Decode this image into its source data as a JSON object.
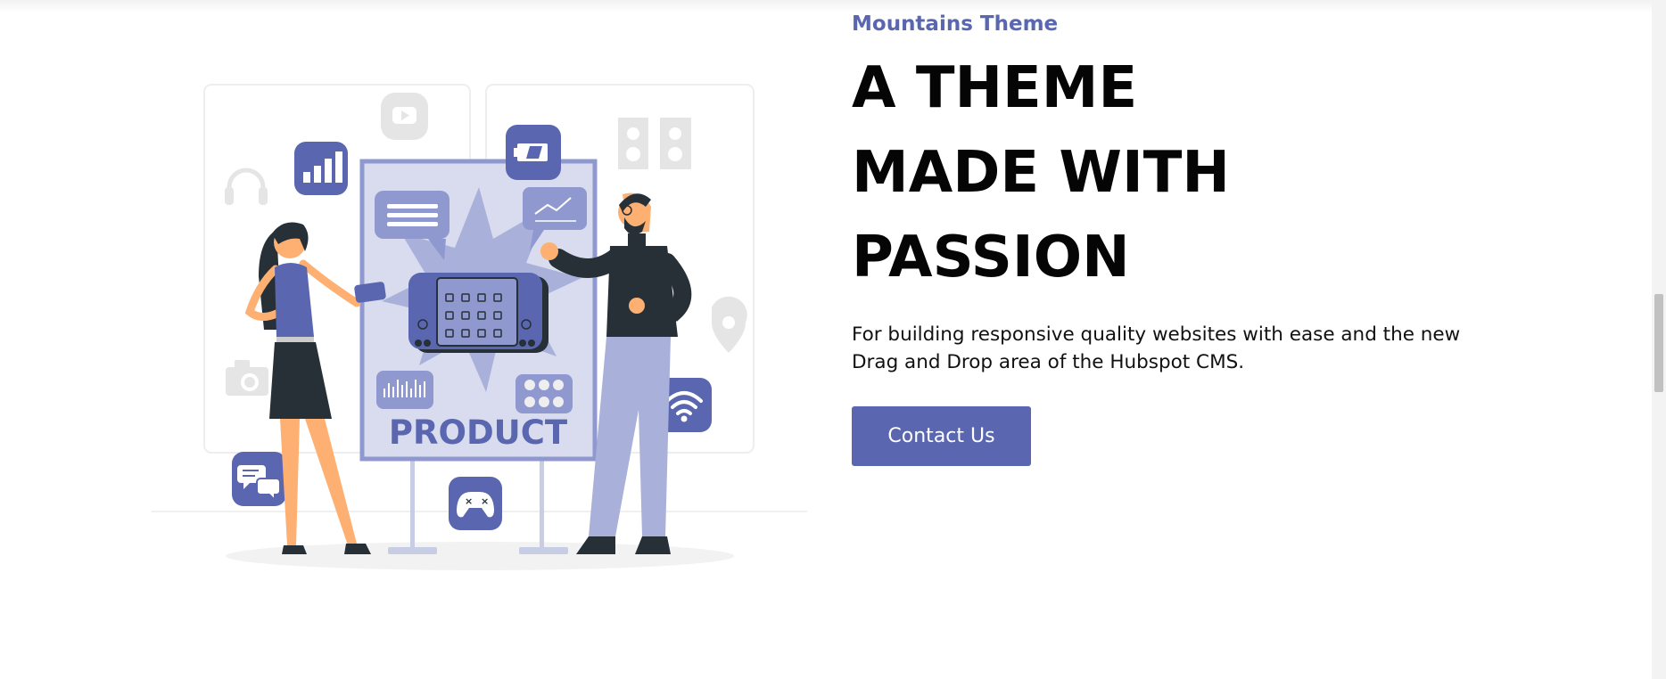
{
  "hero": {
    "eyebrow": "Mountains Theme",
    "headline": [
      "A THEME",
      "MADE WITH",
      "PASSION"
    ],
    "description": "For building responsive quality websites with ease and the new Drag and Drop area of the Hubspot CMS.",
    "cta_label": "Contact Us"
  },
  "illustration": {
    "board_text": "PRODUCT",
    "icons": [
      "youtube-icon",
      "bar-chart-icon",
      "battery-icon",
      "speakers-icon",
      "headphones-icon",
      "message-icon",
      "line-chart-icon",
      "map-pin-icon",
      "camera-icon",
      "chat-icon",
      "gamepad-icon",
      "wifi-icon",
      "audio-bars-icon",
      "buttons-grid-icon"
    ]
  },
  "colors": {
    "accent": "#5a67b0",
    "accent_light": "#8f99cf",
    "accent_pale": "#d8dcee",
    "heading": "#050505",
    "text": "#111111",
    "skin": "#fdb072",
    "dark": "#263036"
  }
}
